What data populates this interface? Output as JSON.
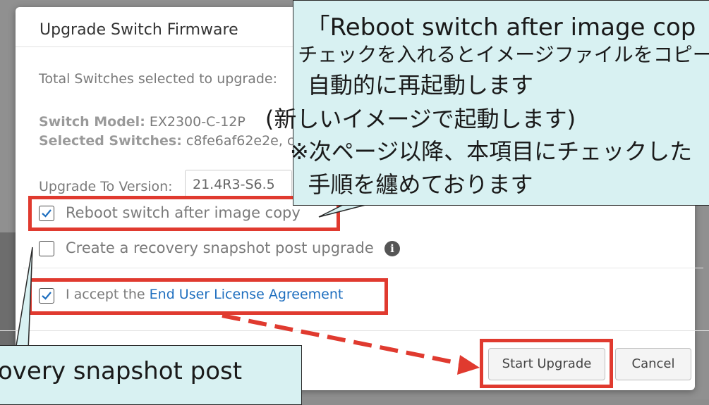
{
  "dialog": {
    "title": "Upgrade Switch Firmware",
    "total_switches_label": "Total Switches selected to upgrade:",
    "switch_model_label": "Switch Model:",
    "switch_model_value": "EX2300-C-12P",
    "selected_switches_label": "Selected Switches:",
    "selected_switches_value": "c8fe6af62e2e, c",
    "upgrade_version_label": "Upgrade To Version:",
    "upgrade_version_value": "21.4R3-S6.5",
    "options": [
      {
        "label": "Reboot switch after image copy",
        "checked": true
      },
      {
        "label": "Create a recovery snapshot post upgrade",
        "checked": false
      },
      {
        "label_prefix": "I accept the",
        "link": "End User License Agreement",
        "checked": true
      }
    ],
    "info_icon": "info-icon",
    "buttons": {
      "start": "Start Upgrade",
      "cancel": "Cancel"
    }
  },
  "callout_top": {
    "lines": [
      "「Reboot switch after image cop",
      "チェックを入れるとイメージファイルをコピー",
      "自動的に再起動します",
      "(新しいイメージで起動します)",
      "※次ページ以降、本項目にチェックした",
      "手順を纏めております"
    ]
  },
  "callout_bottom": {
    "lines": [
      "overy snapshot post"
    ]
  },
  "colors": {
    "highlight": "#e03a2f",
    "callout_bg": "#d8f1f2",
    "link": "#1f6fbf"
  }
}
